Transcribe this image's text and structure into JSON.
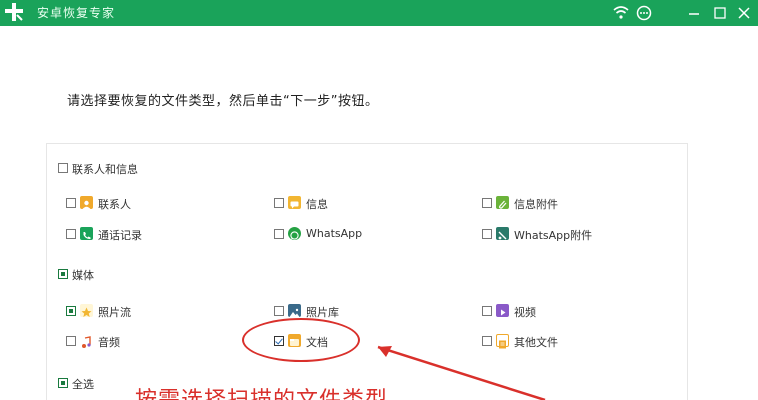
{
  "window": {
    "title": "安卓恢复专家",
    "controls": {
      "wifi": "wifi-icon",
      "chat": "chat-icon",
      "minimize": "minimize-icon",
      "maximize": "maximize-icon",
      "close": "close-icon"
    }
  },
  "instruction": "请选择要恢复的文件类型，然后单击“下一步”按钮。",
  "groups": {
    "contacts": {
      "label": "联系人和信息",
      "items": [
        {
          "label": "联系人",
          "icon": "contacts-icon",
          "color": "#f0a92c"
        },
        {
          "label": "信息",
          "icon": "message-icon",
          "color": "#f2b632"
        },
        {
          "label": "信息附件",
          "icon": "attachment-icon",
          "color": "#6bb33a"
        },
        {
          "label": "通话记录",
          "icon": "phone-icon",
          "color": "#1aa35a"
        },
        {
          "label": "WhatsApp",
          "icon": "whatsapp-icon",
          "color": "#25a244"
        },
        {
          "label": "WhatsApp附件",
          "icon": "whatsapp-attachment-icon",
          "color": "#2a7a6a"
        }
      ]
    },
    "media": {
      "label": "媒体",
      "items": [
        {
          "label": "照片流",
          "icon": "photo-stream-icon",
          "color": "#f2b632"
        },
        {
          "label": "照片库",
          "icon": "photo-library-icon",
          "color": "#3a6a8a"
        },
        {
          "label": "视频",
          "icon": "video-icon",
          "color": "#8a5ac8"
        },
        {
          "label": "音频",
          "icon": "audio-icon",
          "color": "#e0572a"
        },
        {
          "label": "文档",
          "icon": "document-icon",
          "color": "#f0a92c"
        },
        {
          "label": "其他文件",
          "icon": "other-files-icon",
          "color": "#f0a92c"
        }
      ]
    },
    "all": {
      "label": "全选"
    }
  },
  "annotation": "按需选择扫描的文件类型",
  "colors": {
    "titlebar": "#1aa35a",
    "annotation": "#d9302b"
  }
}
